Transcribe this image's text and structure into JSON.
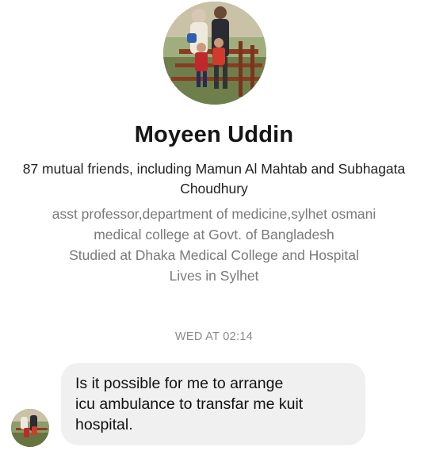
{
  "profile": {
    "name": "Moyeen Uddin",
    "mutual_friends": "87 mutual friends, including Mamun Al Mahtab and Subhagata Choudhury",
    "info_lines": [
      "asst professor,department of medicine,sylhet osmani",
      "medical college at Govt. of Bangladesh",
      "Studied at Dhaka Medical College and Hospital",
      "Lives in Sylhet"
    ]
  },
  "conversation": {
    "timestamp": "WED AT 02:14",
    "messages": [
      {
        "lines": [
          "Is it possible for me to arrange",
          "icu ambulance to transfar me kuit",
          "hospital."
        ]
      }
    ]
  }
}
